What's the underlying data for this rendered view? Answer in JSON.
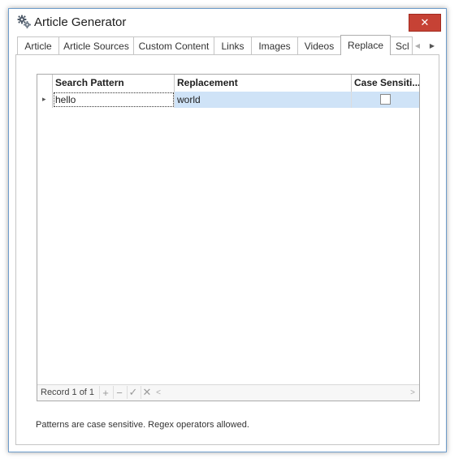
{
  "window": {
    "title": "Article Generator",
    "close_symbol": "✕"
  },
  "tabs": [
    {
      "label": "Article"
    },
    {
      "label": "Article Sources"
    },
    {
      "label": "Custom Content"
    },
    {
      "label": "Links"
    },
    {
      "label": "Images"
    },
    {
      "label": "Videos"
    },
    {
      "label": "Replace",
      "active": true
    },
    {
      "label": "Scl"
    }
  ],
  "tab_scroll": {
    "left": "◀",
    "right": "▶"
  },
  "grid": {
    "columns": [
      "Search Pattern",
      "Replacement",
      "Case Sensiti..."
    ],
    "rows": [
      {
        "indicator": "▸",
        "search_pattern": "hello",
        "replacement": "world",
        "case_sensitive": false
      }
    ],
    "navigator": {
      "record_text": "Record 1 of 1",
      "add": "+",
      "remove": "−",
      "apply": "✓",
      "cancel": "✕",
      "scroll_left": "<",
      "scroll_right": ">"
    }
  },
  "hint": "Patterns are case sensitive. Regex operators allowed.",
  "colors": {
    "close_button": "#c64235",
    "selected_row": "#cfe3f7",
    "window_border": "#6d9ccb"
  }
}
